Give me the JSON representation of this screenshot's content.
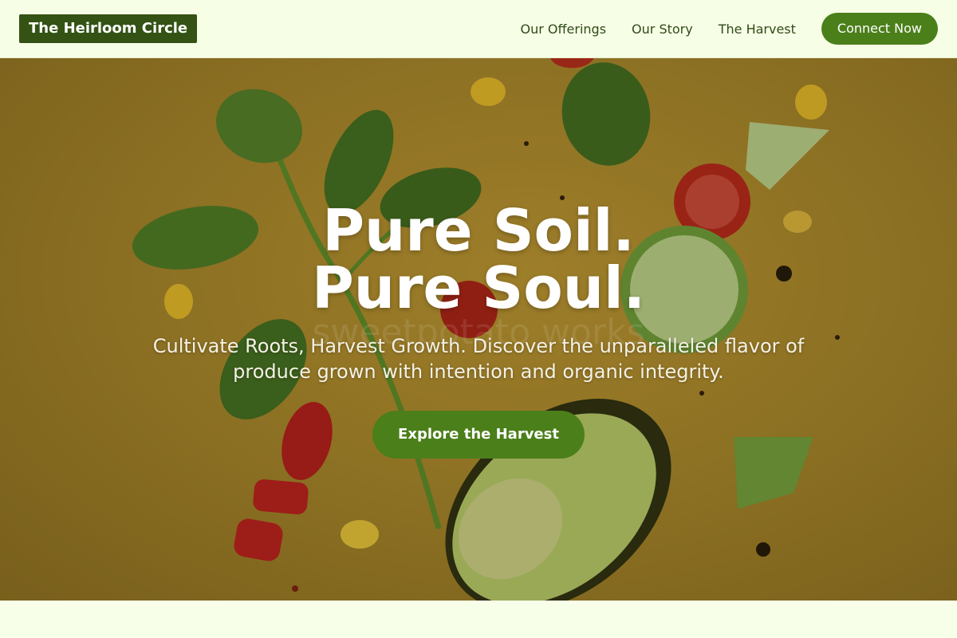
{
  "header": {
    "brand": "The Heirloom Circle",
    "nav": [
      {
        "label": "Our Offerings"
      },
      {
        "label": "Our Story"
      },
      {
        "label": "The Harvest"
      }
    ],
    "cta_label": "Connect Now"
  },
  "hero": {
    "title_line1": "Pure Soil.",
    "title_line2": "Pure Soul.",
    "subtitle_line1": "Cultivate Roots, Harvest Growth. Discover the unparalleled flavor of",
    "subtitle_line2": "produce grown with intention and organic integrity.",
    "button_label": "Explore the Harvest",
    "watermark_text": "sweetpotato works"
  },
  "colors": {
    "brand_dark_green": "#335214",
    "accent_green": "#4b7f1a",
    "page_background": "#f8ffe9",
    "hero_mustard": "#a5852c"
  }
}
